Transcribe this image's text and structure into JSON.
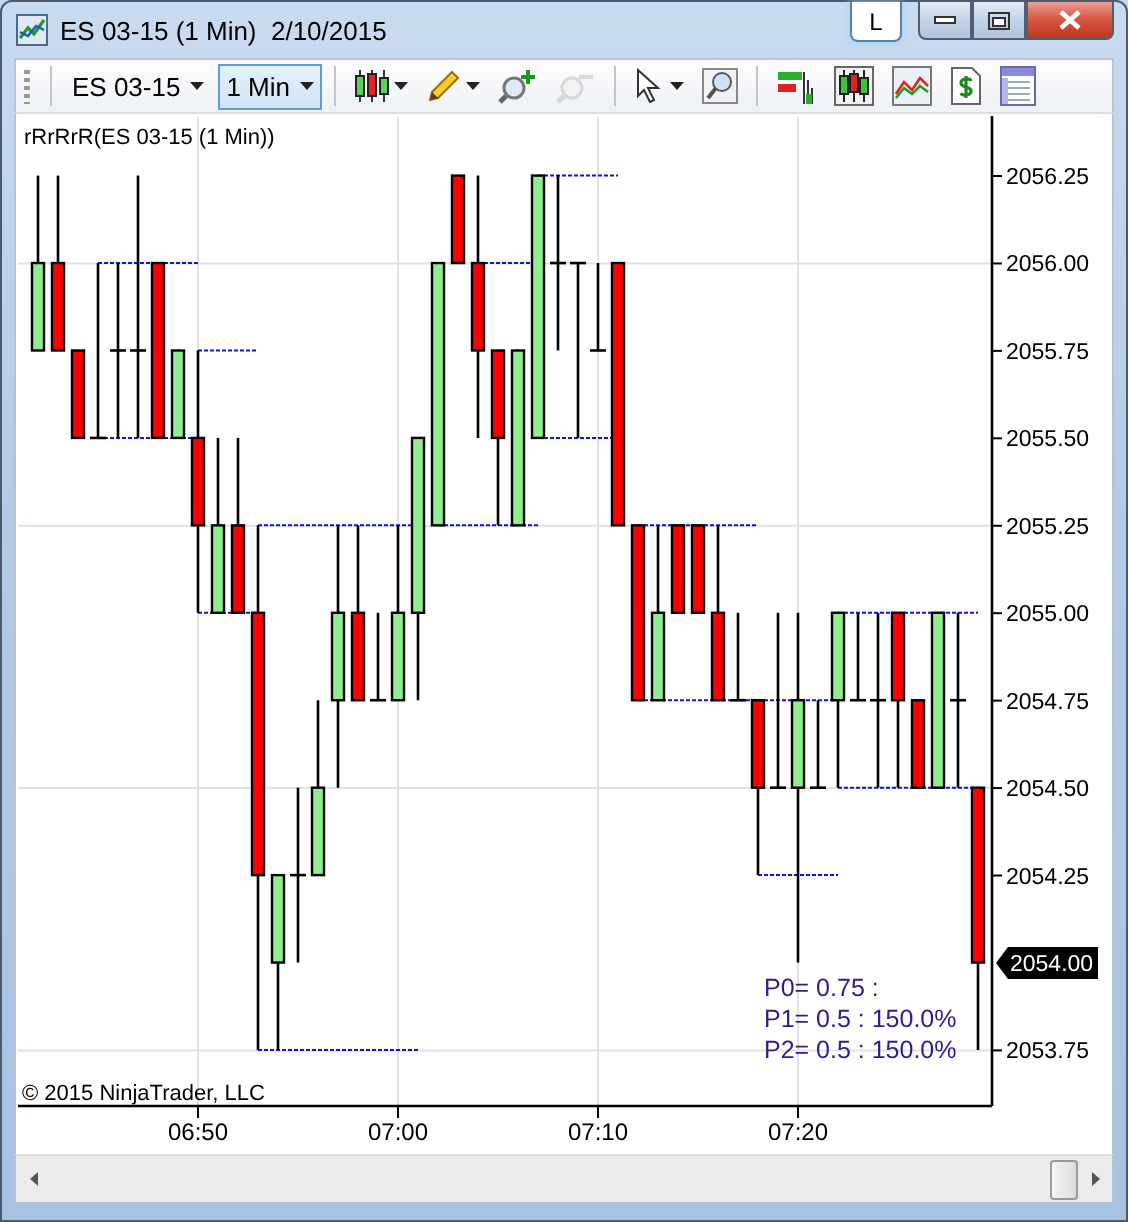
{
  "window": {
    "title": "ES 03-15 (1 Min)  2/10/2015",
    "user_button": "L"
  },
  "toolbar": {
    "instrument": "ES 03-15",
    "interval": {
      "value": "1 Min",
      "active": true
    },
    "tool_groups": [
      [
        {
          "kind": "candles",
          "menu": true,
          "disabled": false
        },
        {
          "kind": "pencil",
          "menu": true,
          "disabled": false
        },
        {
          "kind": "zoom-in",
          "menu": false,
          "disabled": false
        },
        {
          "kind": "zoom-out",
          "menu": false,
          "disabled": true
        }
      ],
      [
        {
          "kind": "pointer",
          "menu": true,
          "disabled": false
        },
        {
          "kind": "magnifier",
          "menu": false,
          "disabled": false
        }
      ],
      [
        {
          "kind": "bars",
          "menu": false,
          "disabled": false
        },
        {
          "kind": "boxed-candles",
          "menu": false,
          "disabled": false
        },
        {
          "kind": "area-chart",
          "menu": false,
          "disabled": false
        },
        {
          "kind": "dollar",
          "menu": false,
          "disabled": false
        },
        {
          "kind": "properties",
          "menu": false,
          "disabled": false
        }
      ]
    ]
  },
  "chart": {
    "indicator_label": "rRrRrR(ES 03-15 (1 Min))",
    "price_axis": [
      {
        "kind": "tick",
        "label": "2056.25"
      },
      {
        "kind": "tick",
        "label": "2056.00"
      },
      {
        "kind": "tick",
        "label": "2055.75"
      },
      {
        "kind": "tick",
        "label": "2055.50"
      },
      {
        "kind": "tick",
        "label": "2055.25"
      },
      {
        "kind": "tick",
        "label": "2055.00"
      },
      {
        "kind": "tick",
        "label": "2054.75"
      },
      {
        "kind": "tick",
        "label": "2054.50"
      },
      {
        "kind": "tick",
        "label": "2054.25"
      },
      {
        "kind": "last",
        "label": "2054.00"
      },
      {
        "kind": "tick",
        "label": "2053.75"
      }
    ],
    "time_axis": [
      "06:50",
      "07:00",
      "07:10",
      "07:20"
    ],
    "copyright": "© 2015 NinjaTrader, LLC",
    "readout": [
      "P0= 0.75 :",
      "P1= 0.5 : 150.0%",
      "P2= 0.5 : 150.0%"
    ]
  }
}
